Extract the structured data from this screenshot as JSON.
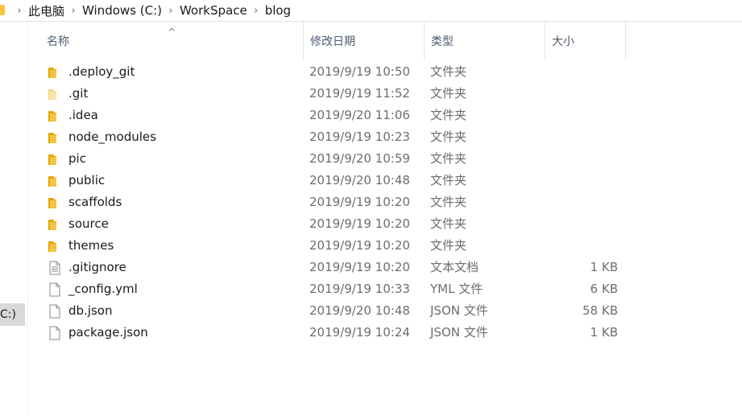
{
  "breadcrumb": {
    "items": [
      "此电脑",
      "Windows (C:)",
      "WorkSpace",
      "blog"
    ],
    "separator": "›"
  },
  "navigation": {
    "drive_label": "C:)"
  },
  "columns": {
    "name": "名称",
    "date": "修改日期",
    "type": "类型",
    "size": "大小",
    "sort_indicator": "^"
  },
  "files": [
    {
      "name": ".deploy_git",
      "date": "2019/9/19 10:50",
      "type": "文件夹",
      "size": "",
      "icon": "folder-icon"
    },
    {
      "name": ".git",
      "date": "2019/9/19 11:52",
      "type": "文件夹",
      "size": "",
      "icon": "folder-icon-faded"
    },
    {
      "name": ".idea",
      "date": "2019/9/20 11:06",
      "type": "文件夹",
      "size": "",
      "icon": "folder-icon"
    },
    {
      "name": "node_modules",
      "date": "2019/9/19 10:23",
      "type": "文件夹",
      "size": "",
      "icon": "folder-icon"
    },
    {
      "name": "pic",
      "date": "2019/9/20 10:59",
      "type": "文件夹",
      "size": "",
      "icon": "folder-icon"
    },
    {
      "name": "public",
      "date": "2019/9/20 10:48",
      "type": "文件夹",
      "size": "",
      "icon": "folder-icon"
    },
    {
      "name": "scaffolds",
      "date": "2019/9/19 10:20",
      "type": "文件夹",
      "size": "",
      "icon": "folder-icon"
    },
    {
      "name": "source",
      "date": "2019/9/19 10:20",
      "type": "文件夹",
      "size": "",
      "icon": "folder-icon"
    },
    {
      "name": "themes",
      "date": "2019/9/19 10:20",
      "type": "文件夹",
      "size": "",
      "icon": "folder-icon"
    },
    {
      "name": ".gitignore",
      "date": "2019/9/19 10:20",
      "type": "文本文档",
      "size": "1 KB",
      "icon": "text-file-icon"
    },
    {
      "name": "_config.yml",
      "date": "2019/9/19 10:33",
      "type": "YML 文件",
      "size": "6 KB",
      "icon": "file-icon"
    },
    {
      "name": "db.json",
      "date": "2019/9/20 10:48",
      "type": "JSON 文件",
      "size": "58 KB",
      "icon": "file-icon"
    },
    {
      "name": "package.json",
      "date": "2019/9/19 10:24",
      "type": "JSON 文件",
      "size": "1 KB",
      "icon": "file-icon"
    }
  ],
  "colors": {
    "folder": "#f4c542",
    "folder_shadow": "#e0a800",
    "header_text": "#4d5b73",
    "secondary_text": "#6d6d6d"
  }
}
